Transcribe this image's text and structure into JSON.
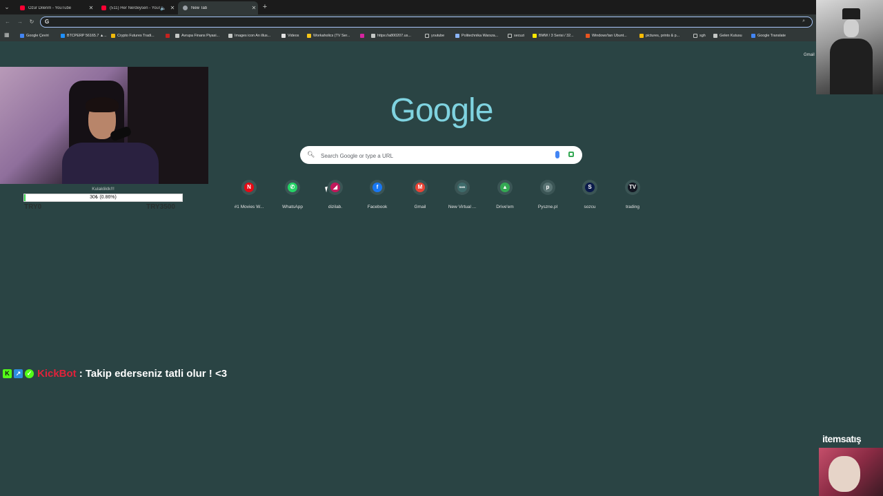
{
  "tabs": [
    {
      "title": "Özür Dilerim - YouTube",
      "favicon": "youtube-icon",
      "active": false
    },
    {
      "title": "(511) Her Nerdeysen - YouTube",
      "favicon": "youtube-icon",
      "active": false,
      "audio": "speaker-icon"
    },
    {
      "title": "New Tab",
      "favicon": "chrome-newtab-icon",
      "active": true
    }
  ],
  "omnibox": {
    "value": "",
    "zoom_icon": "zoom-icon"
  },
  "bookmarks": [
    {
      "label": "Google Çeviri",
      "icon": "google-translate-icon",
      "color": "#4285f4"
    },
    {
      "label": "BTCPERP 56165.7 ▲...",
      "icon": "chart-icon",
      "color": "#1e90ff"
    },
    {
      "label": "Crypto Futures Tradi...",
      "icon": "binance-icon",
      "color": "#f0b90b"
    },
    {
      "label": "",
      "icon": "red-bookmark-icon",
      "color": "#c5221f"
    },
    {
      "label": "Avrupa Finans Piyasi...",
      "icon": "investing-icon",
      "color": "#c4c7c5"
    },
    {
      "label": "Images icon An illus...",
      "icon": "page-icon",
      "color": "#c4c7c5"
    },
    {
      "label": "Videos",
      "icon": "google-icon",
      "color": "#e3e3e3"
    },
    {
      "label": "Workaholics (TV Ser...",
      "icon": "imdb-icon",
      "color": "#f5c518"
    },
    {
      "label": "",
      "icon": "instagram-icon",
      "color": "#d6249f"
    },
    {
      "label": "https://a800207.us...",
      "icon": "page-icon",
      "color": "#c4c7c5"
    },
    {
      "label": "youtube",
      "icon": "folder-icon",
      "color": "folder"
    },
    {
      "label": "Politechnika Warsza...",
      "icon": "university-icon",
      "color": "#8ab4f8"
    },
    {
      "label": "secuzi",
      "icon": "folder-icon",
      "color": "folder"
    },
    {
      "label": "BMW / 3 Serisi / 32...",
      "icon": "sahibinden-icon",
      "color": "#ffe800"
    },
    {
      "label": "Windows'tan Ubunt...",
      "icon": "ubuntu-icon",
      "color": "#e95420"
    },
    {
      "label": "pictures, prints & p...",
      "icon": "pin-icon",
      "color": "#fbbc04"
    },
    {
      "label": "sgh",
      "icon": "folder-icon",
      "color": "folder"
    },
    {
      "label": "Gelen Kutusu",
      "icon": "outlook-icon",
      "color": "#c4c7c5"
    },
    {
      "label": "Google Translate",
      "icon": "google-translate-icon",
      "color": "#4285f4"
    }
  ],
  "google": {
    "gmail_link": "Gmail",
    "logo": "Google",
    "search_placeholder": "Search Google or type a URL"
  },
  "shortcuts": [
    {
      "label": "#1 Movies W...",
      "icon": "netflix-icon",
      "glyph": "N",
      "color": "#e50914"
    },
    {
      "label": "WhatsApp",
      "icon": "whatsapp-icon",
      "glyph": "✆",
      "color": "#25d366"
    },
    {
      "label": "dizilab.",
      "icon": "dizilab-icon",
      "glyph": "◢",
      "color": "#c2185b"
    },
    {
      "label": "Facebook",
      "icon": "facebook-icon",
      "glyph": "f",
      "color": "#1877f2"
    },
    {
      "label": "Gmail",
      "icon": "gmail-icon",
      "glyph": "M",
      "color": "#ea4335"
    },
    {
      "label": "New Virtual ...",
      "icon": "virtual-icon",
      "glyph": "SMS",
      "color": "#3e6b6b"
    },
    {
      "label": "Drive'em",
      "icon": "drive-icon",
      "glyph": "▲",
      "color": "#34a853"
    },
    {
      "label": "Pyszne.pl",
      "icon": "pyszne-icon",
      "glyph": "p",
      "color": "#5a7474"
    },
    {
      "label": "sozcu",
      "icon": "sozcu-icon",
      "glyph": "S",
      "color": "#0a1a4a"
    },
    {
      "label": "trading",
      "icon": "tradingview-icon",
      "glyph": "TV",
      "color": "#131722"
    }
  ],
  "donation": {
    "title": "Kulakliklk!!!",
    "progress_text": "30₺ (0.86%)",
    "progress_percent": 0.86,
    "min_label": "TRY0",
    "max_label": "TRY3500"
  },
  "chat": {
    "username": "KickBot",
    "message": ": Takip ederseniz tatli olur ! <3"
  },
  "overlay_brand": "itemsatış"
}
